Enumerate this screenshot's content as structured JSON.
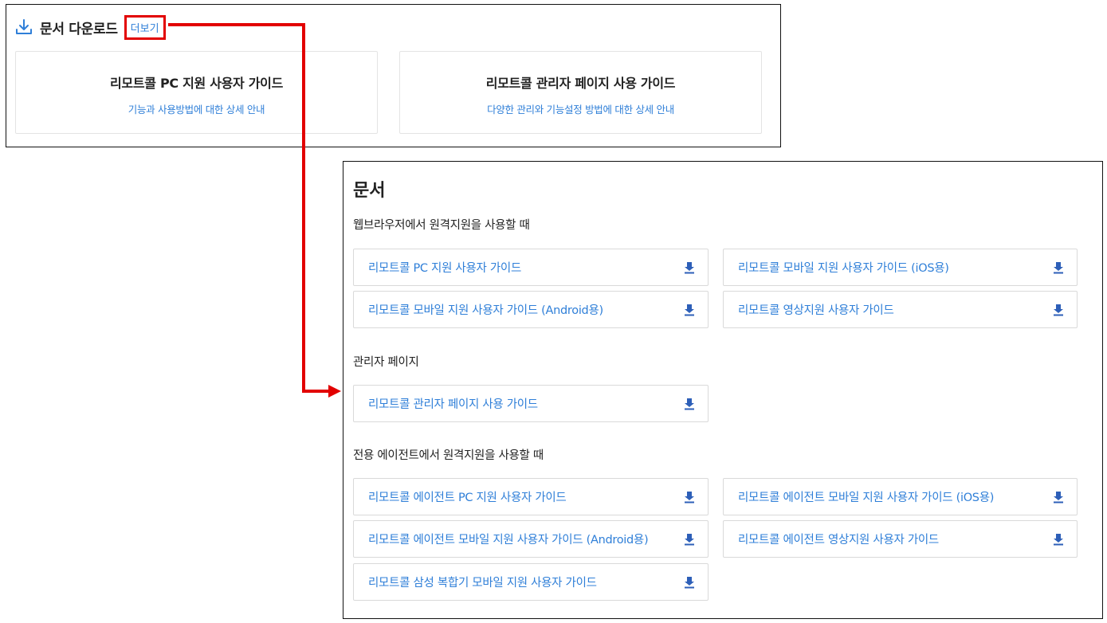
{
  "top": {
    "title": "문서 다운로드",
    "more_label": "더보기",
    "cards": [
      {
        "title": "리모트콜 PC 지원 사용자 가이드",
        "desc": "기능과 사용방법에 대한 상세 안내"
      },
      {
        "title": "리모트콜 관리자 페이지 사용 가이드",
        "desc": "다양한 관리와 기능설정 방법에 대한 상세 안내"
      }
    ]
  },
  "docs": {
    "title": "문서",
    "sections": [
      {
        "label": "웹브라우저에서 원격지원을 사용할 때",
        "items": [
          "리모트콜 PC 지원 사용자 가이드",
          "리모트콜 모바일 지원 사용자 가이드 (iOS용)",
          "리모트콜 모바일 지원 사용자 가이드 (Android용)",
          "리모트콜 영상지원 사용자 가이드"
        ]
      },
      {
        "label": "관리자 페이지",
        "items": [
          "리모트콜 관리자 페이지 사용 가이드"
        ]
      },
      {
        "label": "전용 에이전트에서 원격지원을 사용할 때",
        "items": [
          "리모트콜 에이전트 PC 지원 사용자 가이드",
          "리모트콜 에이전트 모바일 지원 사용자 가이드 (iOS용)",
          "리모트콜 에이전트 모바일 지원 사용자 가이드 (Android용)",
          "리모트콜 에이전트 영상지원 사용자 가이드",
          "리모트콜 삼성 복합기 모바일 지원 사용자 가이드"
        ]
      }
    ]
  },
  "colors": {
    "accent": "#2f7fd8",
    "highlight": "#e20000",
    "download_icon": "#2d5fb8"
  },
  "icons": {
    "header": "download-tray-icon",
    "item": "download-arrow-icon"
  }
}
